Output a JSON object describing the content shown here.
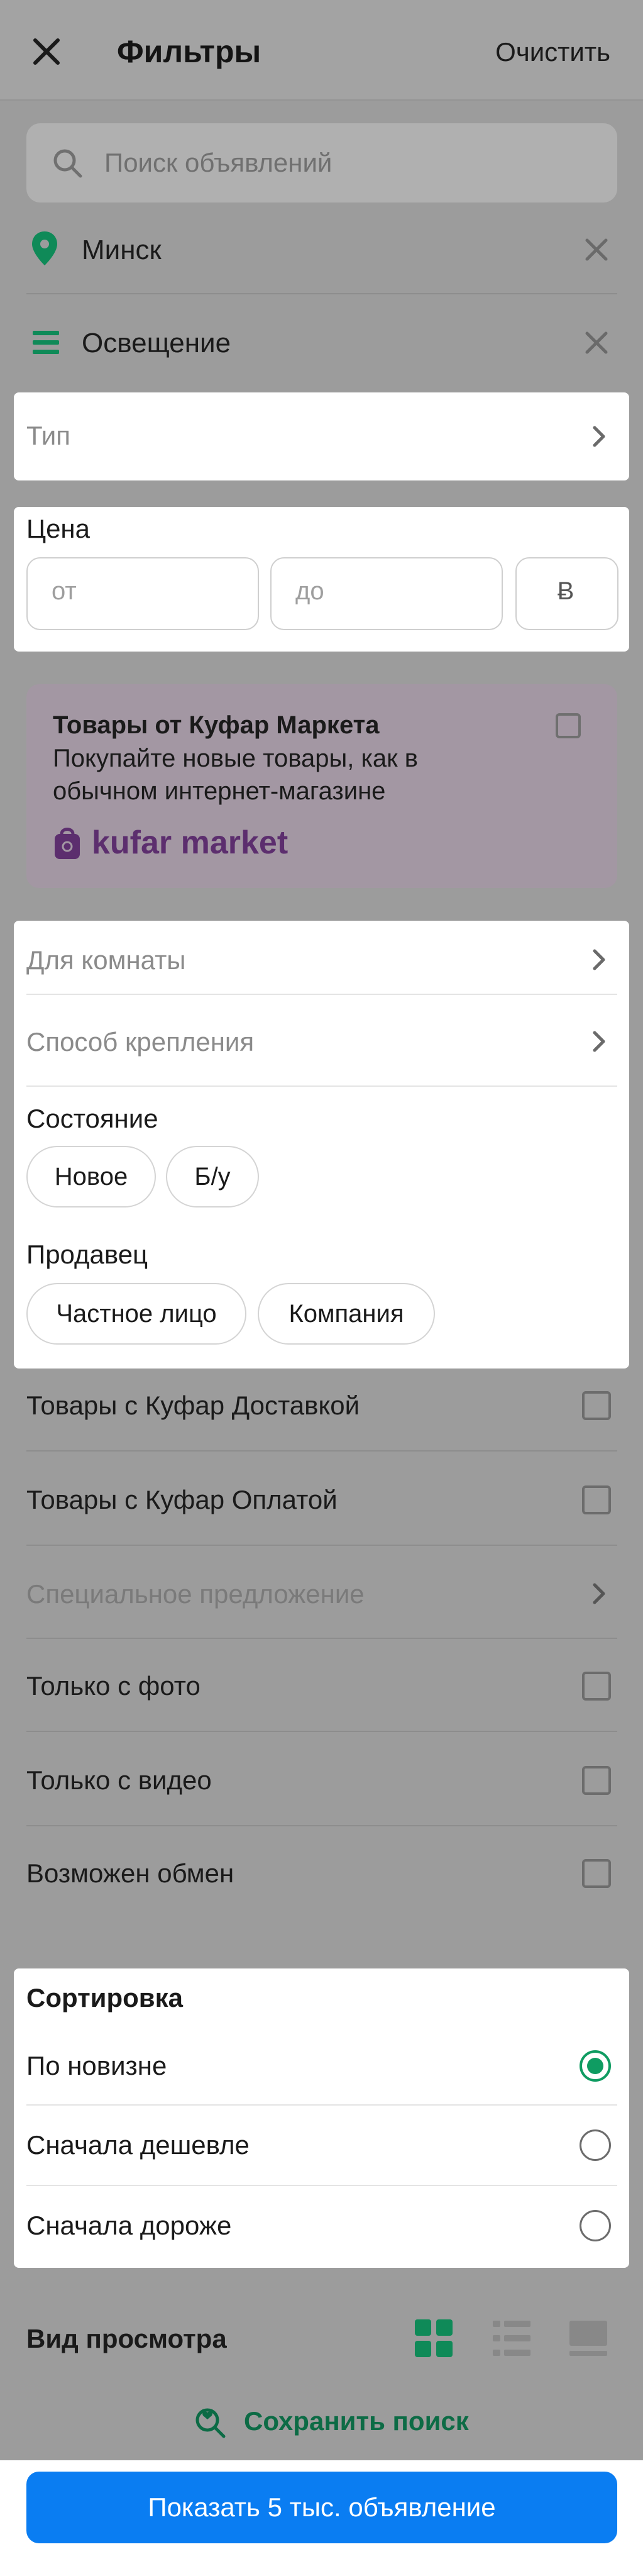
{
  "header": {
    "title": "Фильтры",
    "clear_label": "Очистить",
    "close_icon": "close-icon"
  },
  "search": {
    "placeholder": "Поиск объявлений",
    "icon": "search-icon"
  },
  "location": {
    "value": "Минск",
    "icon": "map-pin-icon"
  },
  "category": {
    "value": "Освещение",
    "icon": "list-icon"
  },
  "type": {
    "label": "Тип"
  },
  "price": {
    "label": "Цена",
    "from_placeholder": "от",
    "to_placeholder": "до",
    "currency": "Ƀ"
  },
  "promo": {
    "title": "Товары от Куфар Маркета",
    "description": "Покупайте новые товары, как в обычном интернет-магазине",
    "logo_text": "kufar market"
  },
  "filters": {
    "room": "Для комнаты",
    "mount": "Способ крепления",
    "condition_label": "Состояние",
    "condition_options": [
      "Новое",
      "Б/у"
    ],
    "seller_label": "Продавец",
    "seller_options": [
      "Частное лицо",
      "Компания"
    ]
  },
  "toggles": [
    {
      "label": "Товары с Куфар Доставкой"
    },
    {
      "label": "Товары с Куфар Оплатой"
    },
    {
      "label": "Специальное предложение"
    },
    {
      "label": "Только с фото"
    },
    {
      "label": "Только с видео"
    },
    {
      "label": "Возможен обмен"
    }
  ],
  "sort": {
    "label": "Сортировка",
    "options": [
      "По новизне",
      "Сначала дешевле",
      "Сначала дороже"
    ],
    "selected": "По новизне"
  },
  "view": {
    "label": "Вид просмотра",
    "active": "grid"
  },
  "save_search": {
    "label": "Сохранить поиск"
  },
  "cta": {
    "label": "Показать 5 тыс. объявление"
  },
  "colors": {
    "accent": "#0f9c62",
    "primary": "#0a7df2",
    "promo": "#5c2e6e"
  }
}
